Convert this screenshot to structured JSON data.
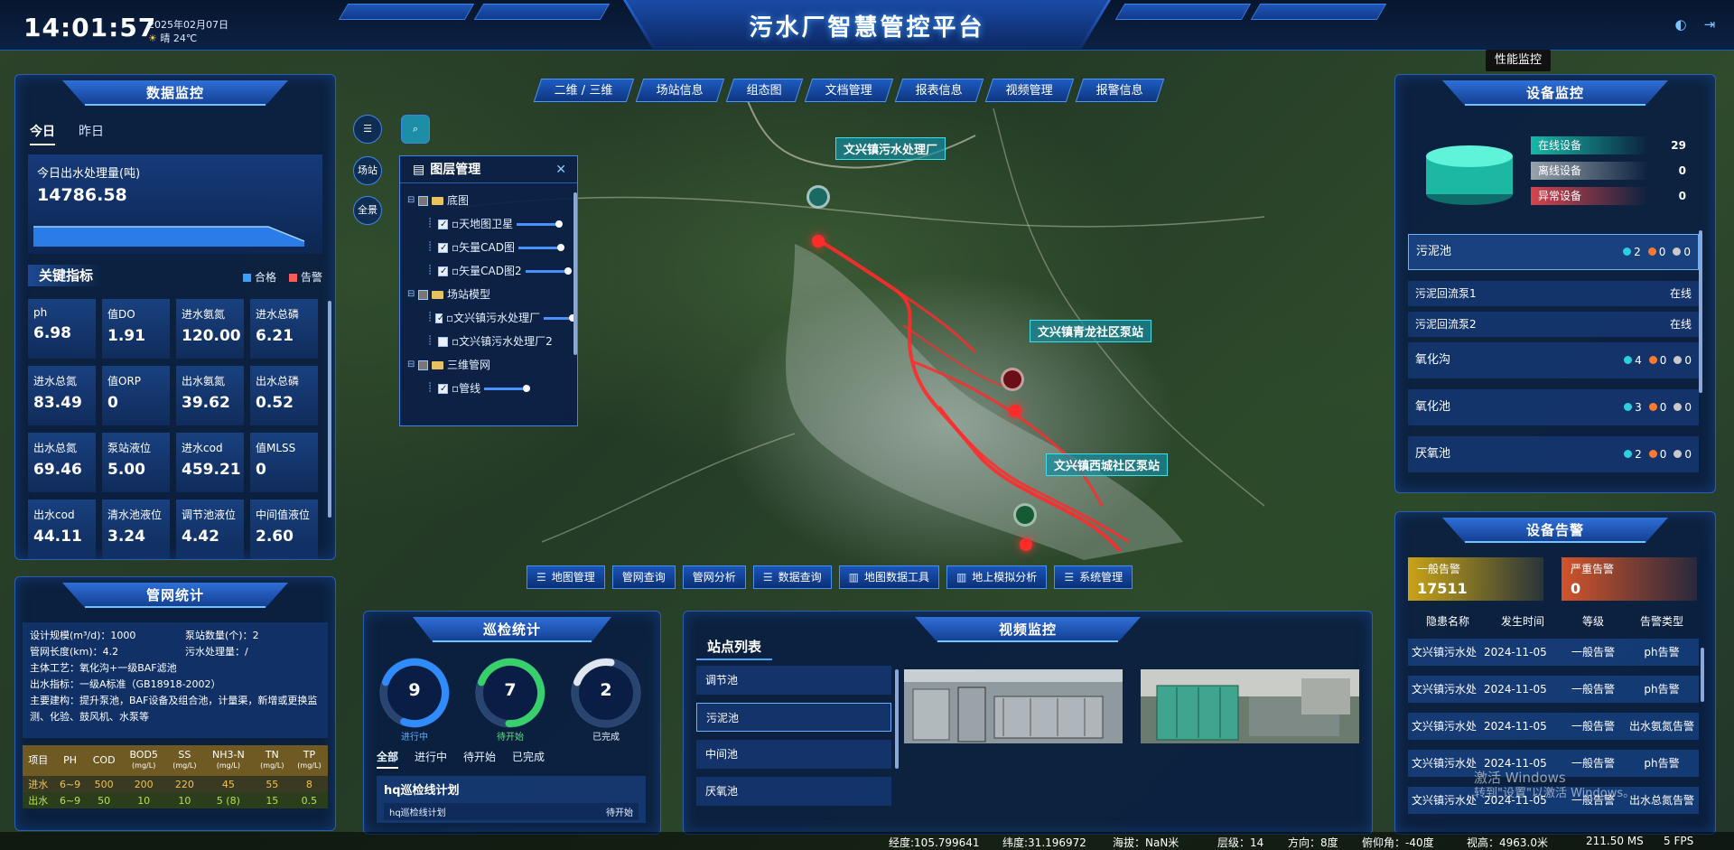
{
  "header": {
    "time": "14:01:57",
    "date": "2025年02月07日",
    "weather": "晴 24℃",
    "title": "污水厂智慧管控平台",
    "perf_tooltip": "性能监控"
  },
  "data_monitor": {
    "title": "数据监控",
    "tabs": [
      "今日",
      "昨日"
    ],
    "output_label": "今日出水处理量(吨)",
    "output_value": "14786.58",
    "kpi_title": "关键指标",
    "legend_ok": "合格",
    "legend_alarm": "告警",
    "kpis": [
      {
        "k": "ph",
        "v": "6.98"
      },
      {
        "k": "值DO",
        "v": "1.91"
      },
      {
        "k": "进水氨氮",
        "v": "120.00"
      },
      {
        "k": "进水总磷",
        "v": "6.21"
      },
      {
        "k": "进水总氮",
        "v": "83.49"
      },
      {
        "k": "值ORP",
        "v": "0"
      },
      {
        "k": "出水氨氮",
        "v": "39.62"
      },
      {
        "k": "出水总磷",
        "v": "0.52"
      },
      {
        "k": "出水总氮",
        "v": "69.46"
      },
      {
        "k": "泵站液位",
        "v": "5.00"
      },
      {
        "k": "进水cod",
        "v": "459.21"
      },
      {
        "k": "值MLSS",
        "v": "0"
      },
      {
        "k": "出水cod",
        "v": "44.11"
      },
      {
        "k": "清水池液位",
        "v": "3.24"
      },
      {
        "k": "调节池液位",
        "v": "4.42"
      },
      {
        "k": "中间值液位",
        "v": "2.60"
      }
    ]
  },
  "pipe_stats": {
    "title": "管网统计",
    "design_scale": "设计规模(m³/d)：1000",
    "pump_count": "泵站数量(个)：2",
    "pipe_length": "管网长度(km)：4.2",
    "sewage_capacity": "污水处理量：/",
    "process": "主体工艺：氧化沟+一级BAF滤池",
    "standard": "出水指标：一级A标准（GB18918-2002）",
    "construction": "主要建构：提升泵池，BAF设备及组合池，计量渠，新增或更换监测、化验、鼓风机、水泵等",
    "table_headers": [
      {
        "name": "项目",
        "unit": ""
      },
      {
        "name": "PH",
        "unit": ""
      },
      {
        "name": "COD",
        "unit": ""
      },
      {
        "name": "BOD5",
        "unit": "(mg/L)"
      },
      {
        "name": "SS",
        "unit": "(mg/L)"
      },
      {
        "name": "NH3-N",
        "unit": "(mg/L)"
      },
      {
        "name": "TN",
        "unit": "(mg/L)"
      },
      {
        "name": "TP",
        "unit": "(mg/L)"
      }
    ],
    "rows": [
      [
        "进水",
        "6~9",
        "500",
        "200",
        "220",
        "45",
        "55",
        "8"
      ],
      [
        "出水",
        "6~9",
        "50",
        "10",
        "10",
        "5 (8)",
        "15",
        "0.5"
      ]
    ]
  },
  "map": {
    "top_nav": [
      "二维 / 三维",
      "场站信息",
      "组态图",
      "文档管理",
      "报表信息",
      "视频管理",
      "报警信息"
    ],
    "side_buttons": [
      "场站",
      "全景"
    ],
    "labels": [
      "文兴镇污水处理厂",
      "文兴镇青龙社区泵站",
      "文兴镇西城社区泵站"
    ],
    "bottom_tools": [
      "地图管理",
      "管网查询",
      "管网分析",
      "数据查询",
      "地图数据工具",
      "地上模拟分析",
      "系统管理"
    ]
  },
  "layer_panel": {
    "title": "图层管理",
    "tree": [
      {
        "label": "底图",
        "level": 0,
        "type": "folder"
      },
      {
        "label": "天地图卫星",
        "level": 1,
        "type": "leaf",
        "slider": true
      },
      {
        "label": "矢量CAD图",
        "level": 1,
        "type": "leaf",
        "slider": true
      },
      {
        "label": "矢量CAD图2",
        "level": 1,
        "type": "leaf",
        "slider": true
      },
      {
        "label": "场站模型",
        "level": 0,
        "type": "folder"
      },
      {
        "label": "文兴镇污水处理厂",
        "level": 1,
        "type": "leaf",
        "slider": true
      },
      {
        "label": "文兴镇污水处理厂2",
        "level": 1,
        "type": "leaf",
        "slider": false
      },
      {
        "label": "三维管网",
        "level": 0,
        "type": "folder"
      },
      {
        "label": "管线",
        "level": 1,
        "type": "leaf",
        "slider": true
      }
    ]
  },
  "patrol": {
    "title": "巡检统计",
    "rings": [
      {
        "num": "9",
        "cap": "进行中",
        "color": "#2f8bff",
        "fraction": 0.75
      },
      {
        "num": "7",
        "cap": "待开始",
        "color": "#37d06a",
        "fraction": 0.7
      },
      {
        "num": "2",
        "cap": "已完成",
        "color": "#dfe6ef",
        "fraction": 0.22
      }
    ],
    "tabs": [
      "全部",
      "进行中",
      "待开始",
      "已完成"
    ],
    "plan_title": "hq巡检线计划",
    "plan_row_name": "hq巡检线计划",
    "plan_row_status": "待开始"
  },
  "video": {
    "title": "视频监控",
    "station_title": "站点列表",
    "stations": [
      "调节池",
      "污泥池",
      "中间池",
      "厌氧池"
    ]
  },
  "equipment": {
    "title": "设备监控",
    "online_label": "在线设备",
    "online": "29",
    "offline_label": "离线设备",
    "offline": "0",
    "abnormal_label": "异常设备",
    "abnormal": "0",
    "list": [
      {
        "name": "污泥池",
        "a": "2",
        "b": "0",
        "c": "0",
        "kind": "group"
      },
      {
        "name": "污泥回流泵1",
        "status": "在线",
        "kind": "sub"
      },
      {
        "name": "污泥回流泵2",
        "status": "在线",
        "kind": "sub"
      },
      {
        "name": "氧化沟",
        "a": "4",
        "b": "0",
        "c": "0",
        "kind": "group"
      },
      {
        "name": "氧化池",
        "a": "3",
        "b": "0",
        "c": "0",
        "kind": "group"
      },
      {
        "name": "厌氧池",
        "a": "2",
        "b": "0",
        "c": "0",
        "kind": "group"
      }
    ]
  },
  "alarms": {
    "title": "设备告警",
    "general_label": "一般告警",
    "general": "17511",
    "severe_label": "严重告警",
    "severe": "0",
    "headers": [
      "隐患名称",
      "发生时间",
      "等级",
      "告警类型"
    ],
    "rows": [
      [
        "文兴镇污水处",
        "2024-11-05",
        "一般告警",
        "ph告警"
      ],
      [
        "文兴镇污水处",
        "2024-11-05",
        "一般告警",
        "ph告警"
      ],
      [
        "文兴镇污水处",
        "2024-11-05",
        "一般告警",
        "出水氨氮告警"
      ],
      [
        "文兴镇污水处",
        "2024-11-05",
        "一般告警",
        "ph告警"
      ],
      [
        "文兴镇污水处",
        "2024-11-05",
        "一般告警",
        "出水总氮告警"
      ]
    ]
  },
  "status_bar": {
    "lon": "经度:105.799641",
    "lat": "纬度:31.196972",
    "alt": "海拔：NaN米",
    "level": "层级：14",
    "heading": "方向：8度",
    "pitch": "俯仰角：-40度",
    "view_height": "视高：4963.0米",
    "ms": "211.50 MS",
    "fps": "5 FPS"
  },
  "watermark": {
    "line1": "激活 Windows",
    "line2": "转到\"设置\"以激活 Windows。"
  }
}
